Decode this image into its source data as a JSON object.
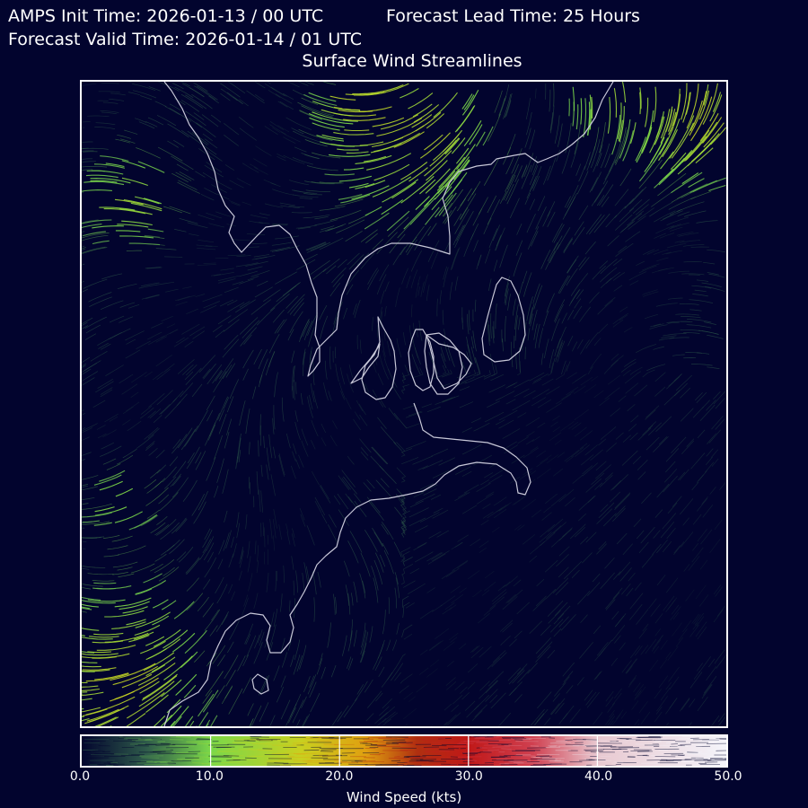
{
  "header": {
    "init_time": "AMPS Init Time: 2026-01-13 / 00 UTC",
    "lead_time": "Forecast Lead Time: 25 Hours",
    "valid_time": "Forecast Valid Time: 2026-01-14 / 01 UTC",
    "title": "Surface Wind Streamlines"
  },
  "colorbar": {
    "label": "Wind Speed (kts)",
    "range": [
      0,
      50
    ],
    "ticks": [
      "0.0",
      "10.0",
      "20.0",
      "30.0",
      "40.0",
      "50.0"
    ],
    "stops": [
      {
        "value": 0,
        "color": "#02042e"
      },
      {
        "value": 5,
        "color": "#2e5a4a"
      },
      {
        "value": 10,
        "color": "#7ad84a"
      },
      {
        "value": 17,
        "color": "#c8d020"
      },
      {
        "value": 22,
        "color": "#e0a010"
      },
      {
        "value": 26,
        "color": "#b03010"
      },
      {
        "value": 30,
        "color": "#c01818"
      },
      {
        "value": 35,
        "color": "#d04050"
      },
      {
        "value": 40,
        "color": "#e8c8d0"
      },
      {
        "value": 50,
        "color": "#f4f4fa"
      }
    ]
  },
  "map": {
    "coastline_color": "#c8c8d8",
    "background": "#02042e"
  }
}
